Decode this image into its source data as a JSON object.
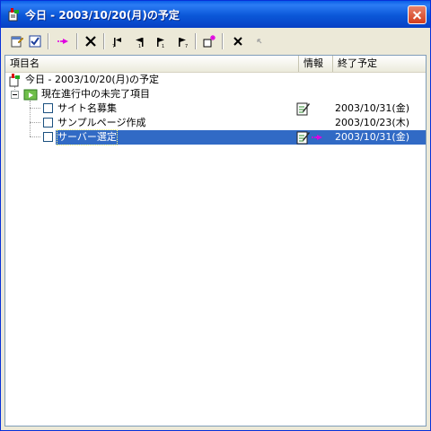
{
  "window": {
    "title": "今日 - 2003/10/20(月)の予定"
  },
  "toolbar": {
    "buttons": [
      {
        "name": "properties-icon"
      },
      {
        "name": "checkbox-icon"
      },
      {
        "name": "forward-arrow-icon"
      },
      {
        "name": "delete-x-icon"
      },
      {
        "name": "flag-prev-icon"
      },
      {
        "name": "flag-left-icon"
      },
      {
        "name": "flag-right-icon"
      },
      {
        "name": "flag-next-icon"
      },
      {
        "name": "new-item-icon"
      },
      {
        "name": "remove-x-icon"
      },
      {
        "name": "undo-disabled-icon"
      }
    ]
  },
  "list": {
    "columns": [
      "項目名",
      "情報",
      "終了予定"
    ],
    "root_label": "今日 - 2003/10/20(月)の予定",
    "group_label": "現在進行中の未完了項目",
    "items": [
      {
        "name": "サイト名募集",
        "info": [
          "memo"
        ],
        "due": "2003/10/31(金)",
        "selected": false
      },
      {
        "name": "サンプルページ作成",
        "info": [],
        "due": "2003/10/23(木)",
        "selected": false
      },
      {
        "name": "サーバー選定",
        "info": [
          "memo",
          "arrow"
        ],
        "due": "2003/10/31(金)",
        "selected": true
      }
    ]
  },
  "colors": {
    "titlebar": "#0A57D8",
    "selection": "#316AC5",
    "accent_arrow": "#E000E0"
  }
}
